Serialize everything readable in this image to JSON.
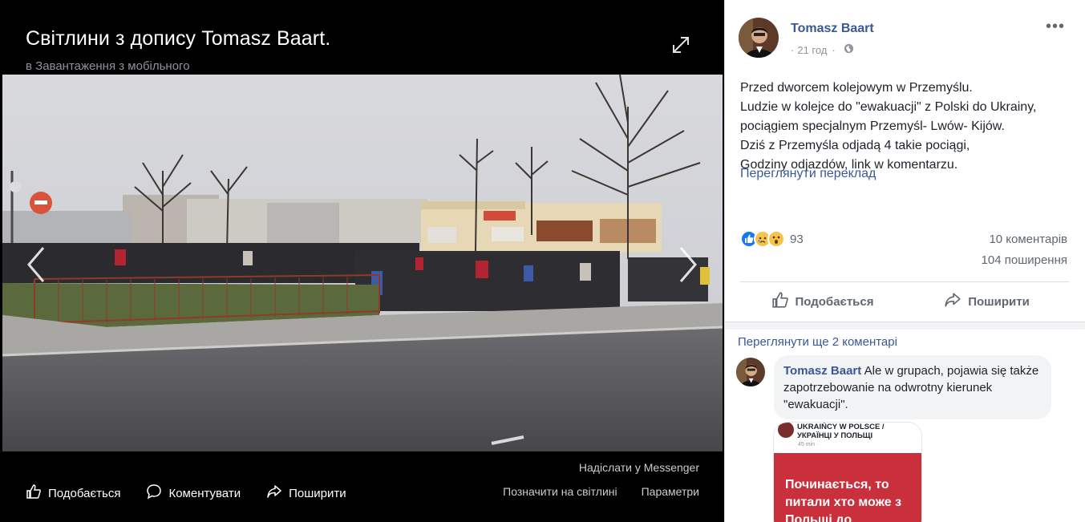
{
  "viewer": {
    "title": "Світлини з допису Tomasz Baart.",
    "album": "в Завантаження з мобільного",
    "send_messenger": "Надіслати у Messenger",
    "actions": {
      "like": "Подобається",
      "comment": "Коментувати",
      "share": "Поширити"
    },
    "links": {
      "tag": "Позначити на світлині",
      "options": "Параметри"
    },
    "icons": [
      "expand-icon",
      "chevron-left-icon",
      "chevron-right-icon",
      "like-icon",
      "comment-icon",
      "share-icon"
    ]
  },
  "post": {
    "author": "Tomasz Baart",
    "time": "21 год",
    "audience_icon": "globe-icon",
    "more": "•••",
    "text_lines": [
      "Przed dworcem kolejowym w Przemyślu.",
      "Ludzie w kolejce do \"ewakuacji\" z Polski do Ukrainy,",
      "pociągiem specjalnym Przemyśl- Lwów- Kijów.",
      "Dziś z Przemyśla odjadą 4 takie pociągi,",
      "Godziny odjazdów, link w komentarzu."
    ],
    "translate": "Переглянути переклад",
    "reactions_count": "93",
    "reaction_icons": [
      "like-reaction-icon",
      "sad-reaction-icon",
      "wow-reaction-icon"
    ],
    "comments_count": "10 коментарів",
    "shares_count": "104 поширення",
    "actions": {
      "like": "Подобається",
      "share": "Поширити"
    }
  },
  "comments": {
    "view_more": "Переглянути ще 2 коментарі",
    "items": [
      {
        "author": "Tomasz Baart",
        "text": "Ale w grupach, pojawia się także zapotrzebowanie na odwrotny kierunek \"ewakuacji\".",
        "attachment": {
          "group_line1": "UKRAIŃCY W POLSCE /",
          "group_line2": "УКРАЇНЦІ У ПОЛЬЩІ",
          "time": "45 min · ",
          "body": "Починається, то питали хто може з Польщі до"
        }
      }
    ]
  },
  "colors": {
    "link_blue": "#385898",
    "meta_gray": "#90949c",
    "viewer_bg": "#000000",
    "attachment_red": "#c9303c"
  }
}
